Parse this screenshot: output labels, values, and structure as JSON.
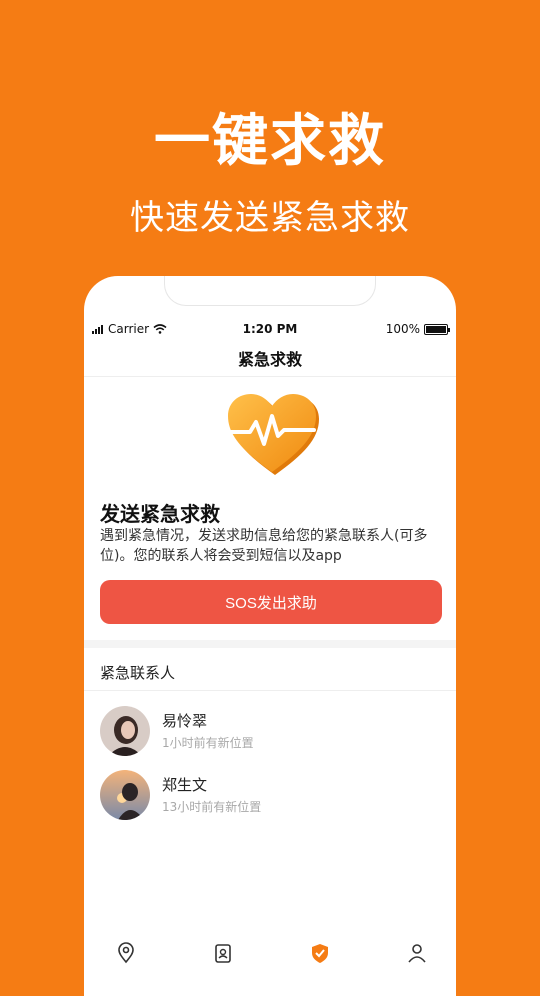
{
  "promo": {
    "title": "一键求救",
    "subtitle": "快速发送紧急求救"
  },
  "status_bar": {
    "carrier": "Carrier",
    "time": "1:20 PM",
    "battery": "100%"
  },
  "nav": {
    "title": "紧急求救"
  },
  "main": {
    "heading": "发送紧急求救",
    "description": "遇到紧急情况，发送求助信息给您的紧急联系人(可多位)。您的联系人将会受到短信以及app",
    "sos_button_label": "SOS发出求助"
  },
  "contacts": {
    "header": "紧急联系人",
    "items": [
      {
        "name": "易怜翠",
        "status": "1小时前有新位置"
      },
      {
        "name": "郑生文",
        "status": "13小时前有新位置"
      }
    ]
  },
  "tab_bar": {
    "icons": [
      "location-pin-icon",
      "contacts-icon",
      "shield-check-icon",
      "profile-icon"
    ]
  },
  "colors": {
    "background": "#f57c14",
    "sos_button": "#ee5544",
    "heart": "#f5a623",
    "active_tab": "#f57c14"
  }
}
